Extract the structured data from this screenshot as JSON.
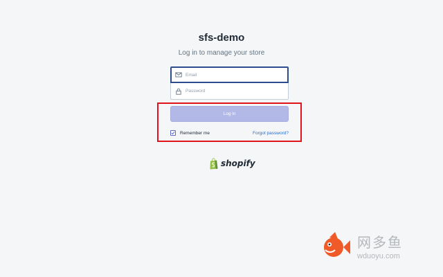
{
  "store": {
    "name": "sfs-demo",
    "subtitle": "Log in to manage your store"
  },
  "form": {
    "email_placeholder": "Email",
    "password_placeholder": "Password",
    "login_label": "Log in",
    "remember_label": "Remember me",
    "remember_checked": true,
    "forgot_label": "Forgot password?"
  },
  "brand": {
    "logo_text": "shopify",
    "logo_icon": "shopify-bag-icon",
    "logo_color": "#95bf47"
  },
  "watermark": {
    "cn_text": "网多鱼",
    "url_text": "wduoyu.com",
    "icon": "fish-icon",
    "color": "#f05a28"
  },
  "colors": {
    "accent": "#5c6ac4",
    "button_disabled": "#b3b9e6",
    "highlight": "#e0121c",
    "link": "#2c6ecb"
  }
}
